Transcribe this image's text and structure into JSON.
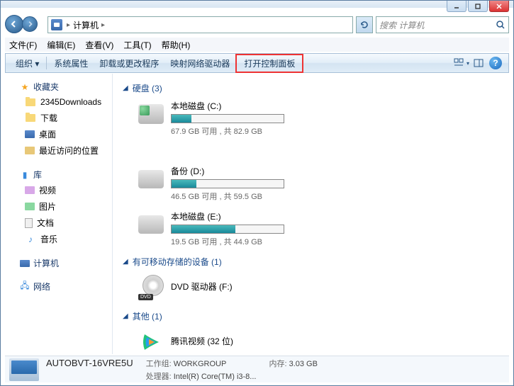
{
  "address": {
    "breadcrumb": [
      "计算机"
    ],
    "search_placeholder": "搜索 计算机"
  },
  "menubar": [
    "文件(F)",
    "编辑(E)",
    "查看(V)",
    "工具(T)",
    "帮助(H)"
  ],
  "toolbar": {
    "organize": "组织",
    "items": [
      "系统属性",
      "卸载或更改程序",
      "映射网络驱动器",
      "打开控制面板"
    ]
  },
  "sidebar": {
    "favorites": {
      "label": "收藏夹",
      "items": [
        "2345Downloads",
        "下载",
        "桌面",
        "最近访问的位置"
      ]
    },
    "libraries": {
      "label": "库",
      "items": [
        "视频",
        "图片",
        "文档",
        "音乐"
      ]
    },
    "computer": {
      "label": "计算机"
    },
    "network": {
      "label": "网络"
    }
  },
  "content": {
    "hdd": {
      "label": "硬盘 (3)",
      "drives": [
        {
          "name": "本地磁盘 (C:)",
          "stats": "67.9 GB 可用 , 共 82.9 GB",
          "fill": 18
        },
        {
          "name": "备份 (D:)",
          "stats": "46.5 GB 可用 , 共 59.5 GB",
          "fill": 22
        },
        {
          "name": "本地磁盘 (E:)",
          "stats": "19.5 GB 可用 , 共 44.9 GB",
          "fill": 57
        }
      ]
    },
    "removable": {
      "label": "有可移动存储的设备 (1)",
      "dvd": "DVD 驱动器 (F:)"
    },
    "other": {
      "label": "其他 (1)",
      "tencent": "腾讯视频 (32 位)"
    }
  },
  "statusbar": {
    "name": "AUTOBVT-16VRE5U",
    "workgroup_label": "工作组:",
    "workgroup": "WORKGROUP",
    "mem_label": "内存:",
    "mem": "3.03 GB",
    "cpu_label": "处理器:",
    "cpu": "Intel(R) Core(TM) i3-8..."
  }
}
